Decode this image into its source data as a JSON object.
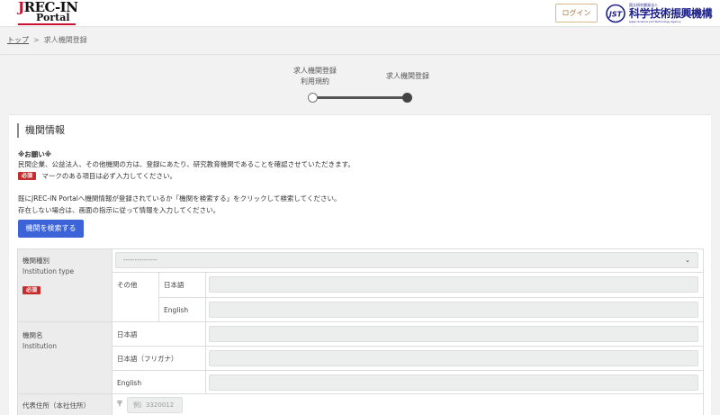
{
  "header": {
    "logo_line1": "REC-IN",
    "logo_j": "J",
    "logo_line2": "Portal",
    "login_label": "ログイン",
    "jst_mark": "JST",
    "jst_small": "国立研究開発法人",
    "jst_name": "科学技術振興機構",
    "jst_en": "Japan Science and Technology Agency"
  },
  "breadcrumb": {
    "home": "トップ",
    "separator": ">",
    "current": "求人機関登録"
  },
  "stepper": {
    "steps": [
      {
        "label_line1": "求人機関登録",
        "label_line2": "利用規約",
        "state": "inactive"
      },
      {
        "label_line1": "求人機関登録",
        "label_line2": "",
        "state": "active"
      }
    ]
  },
  "section": {
    "title": "機関情報",
    "notice_heading": "※お願い※",
    "notice_line1": "民間企業、公益法人、その他機関の方は、登録にあたり、研究教育機関であることを確認させていただきます。",
    "required_badge": "必須",
    "notice_line2": "マークのある項目は必ず入力してください。",
    "notice_line3": "既にJREC-IN Portalへ機関情報が登録されているか「機関を検索する」をクリックして検索してください。",
    "notice_line4": "存在しない場合は、画面の指示に従って情報を入力してください。",
    "search_button": "機関を検索する"
  },
  "form": {
    "institution_type": {
      "label_ja": "機関種別",
      "label_en": "Institution type",
      "required": "必須",
      "select_value": "---------------",
      "other_label": "その他",
      "lang_ja": "日本語",
      "lang_en": "English"
    },
    "institution_name": {
      "label_ja": "機関名",
      "label_en": "Institution",
      "lang_ja": "日本語",
      "lang_kana": "日本語（フリガナ）",
      "lang_en": "English"
    },
    "address": {
      "label_ja": "代表住所（本社住所）",
      "postal_mark": "〒",
      "postal_placeholder": "例）3320012"
    }
  },
  "colors": {
    "accent_blue": "#3c63d8",
    "required_red": "#c62d2d",
    "login_border": "#d9b88a",
    "jst_blue": "#1d2088"
  }
}
